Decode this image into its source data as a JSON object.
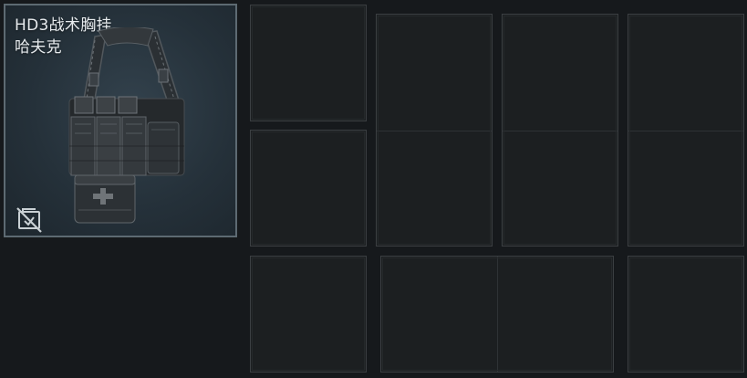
{
  "item": {
    "name_line1": "HD3战术胸挂",
    "name_line2": "哈夫克",
    "icon": "no-insure-icon",
    "art": "tactical-chest-rig-image"
  },
  "slots": [
    {
      "id": "slot-1x1-a",
      "kind": "single"
    },
    {
      "id": "slot-1x1-b",
      "kind": "single"
    },
    {
      "id": "slot-1x2-a",
      "kind": "tall"
    },
    {
      "id": "slot-1x2-b",
      "kind": "tall"
    },
    {
      "id": "slot-1x2-c",
      "kind": "tall"
    },
    {
      "id": "slot-1x1-c",
      "kind": "single"
    },
    {
      "id": "slot-2x1",
      "kind": "wide"
    },
    {
      "id": "slot-1x1-d",
      "kind": "single"
    }
  ],
  "colors": {
    "background": "#16191c",
    "slot_fill": "#1c1f21",
    "slot_border": "#3b3f42",
    "card_border": "#5d6a72",
    "card_fill": "#25313a",
    "text": "#e7ebee"
  }
}
